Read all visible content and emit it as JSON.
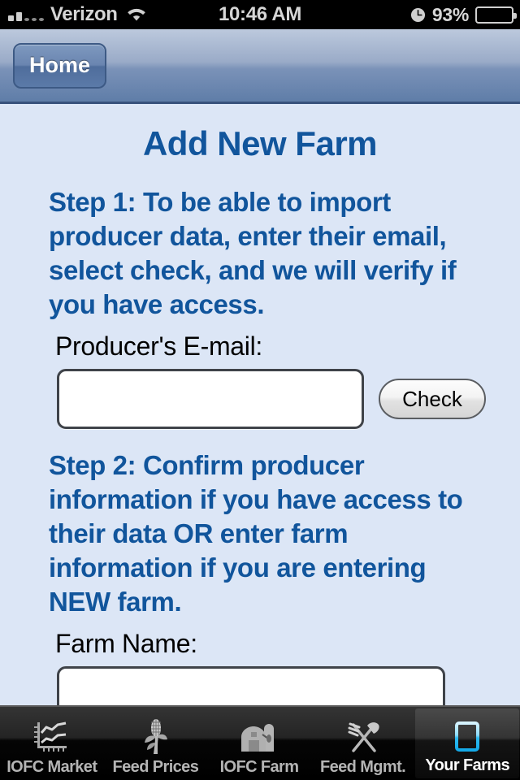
{
  "statusbar": {
    "carrier": "Verizon",
    "time": "10:46 AM",
    "battery_percent": "93%",
    "signal_icon": "signal-bars-icon",
    "wifi_icon": "wifi-icon",
    "alarm_icon": "alarm-clock-icon",
    "battery_icon": "battery-icon"
  },
  "navbar": {
    "back_label": "Home"
  },
  "page": {
    "title": "Add New Farm",
    "step1": "Step 1: To be able to import producer data, enter their email, select check, and we will verify if you have access.",
    "email_label": "Producer's E-mail:",
    "email_value": "",
    "email_placeholder": "",
    "check_label": "Check",
    "step2": "Step 2: Confirm producer information if you have access to their data OR enter farm information if you are entering NEW farm.",
    "farm_name_label": "Farm Name:",
    "farm_name_value": "",
    "farm_name_placeholder": ""
  },
  "tabbar": {
    "items": [
      {
        "label": "IOFC Market",
        "icon": "line-chart-icon",
        "active": false
      },
      {
        "label": "Feed Prices",
        "icon": "corn-stalk-icon",
        "active": false
      },
      {
        "label": "IOFC Farm",
        "icon": "barn-silo-icon",
        "active": false
      },
      {
        "label": "Feed Mgmt.",
        "icon": "fork-shovel-icon",
        "active": false
      },
      {
        "label": "Your Farms",
        "icon": "field-plot-icon",
        "active": true
      }
    ]
  },
  "colors": {
    "accent_blue": "#11559c",
    "content_bg": "#dce6f6",
    "navbar_bottom": "#5f7da8",
    "active_tab_icon": "#4cc6f5"
  }
}
